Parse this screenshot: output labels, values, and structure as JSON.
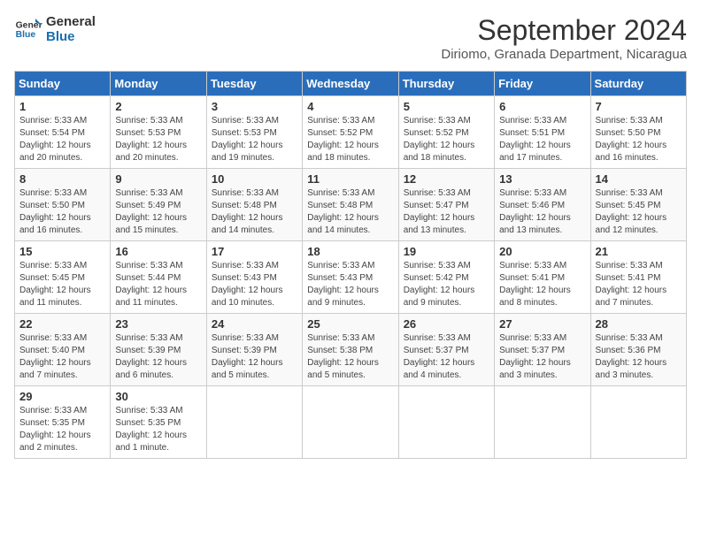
{
  "header": {
    "logo_line1": "General",
    "logo_line2": "Blue",
    "month_year": "September 2024",
    "location": "Diriomo, Granada Department, Nicaragua"
  },
  "weekdays": [
    "Sunday",
    "Monday",
    "Tuesday",
    "Wednesday",
    "Thursday",
    "Friday",
    "Saturday"
  ],
  "weeks": [
    [
      {
        "day": "1",
        "sunrise": "5:33 AM",
        "sunset": "5:54 PM",
        "daylight": "12 hours and 20 minutes."
      },
      {
        "day": "2",
        "sunrise": "5:33 AM",
        "sunset": "5:53 PM",
        "daylight": "12 hours and 20 minutes."
      },
      {
        "day": "3",
        "sunrise": "5:33 AM",
        "sunset": "5:53 PM",
        "daylight": "12 hours and 19 minutes."
      },
      {
        "day": "4",
        "sunrise": "5:33 AM",
        "sunset": "5:52 PM",
        "daylight": "12 hours and 18 minutes."
      },
      {
        "day": "5",
        "sunrise": "5:33 AM",
        "sunset": "5:52 PM",
        "daylight": "12 hours and 18 minutes."
      },
      {
        "day": "6",
        "sunrise": "5:33 AM",
        "sunset": "5:51 PM",
        "daylight": "12 hours and 17 minutes."
      },
      {
        "day": "7",
        "sunrise": "5:33 AM",
        "sunset": "5:50 PM",
        "daylight": "12 hours and 16 minutes."
      }
    ],
    [
      {
        "day": "8",
        "sunrise": "5:33 AM",
        "sunset": "5:50 PM",
        "daylight": "12 hours and 16 minutes."
      },
      {
        "day": "9",
        "sunrise": "5:33 AM",
        "sunset": "5:49 PM",
        "daylight": "12 hours and 15 minutes."
      },
      {
        "day": "10",
        "sunrise": "5:33 AM",
        "sunset": "5:48 PM",
        "daylight": "12 hours and 14 minutes."
      },
      {
        "day": "11",
        "sunrise": "5:33 AM",
        "sunset": "5:48 PM",
        "daylight": "12 hours and 14 minutes."
      },
      {
        "day": "12",
        "sunrise": "5:33 AM",
        "sunset": "5:47 PM",
        "daylight": "12 hours and 13 minutes."
      },
      {
        "day": "13",
        "sunrise": "5:33 AM",
        "sunset": "5:46 PM",
        "daylight": "12 hours and 13 minutes."
      },
      {
        "day": "14",
        "sunrise": "5:33 AM",
        "sunset": "5:45 PM",
        "daylight": "12 hours and 12 minutes."
      }
    ],
    [
      {
        "day": "15",
        "sunrise": "5:33 AM",
        "sunset": "5:45 PM",
        "daylight": "12 hours and 11 minutes."
      },
      {
        "day": "16",
        "sunrise": "5:33 AM",
        "sunset": "5:44 PM",
        "daylight": "12 hours and 11 minutes."
      },
      {
        "day": "17",
        "sunrise": "5:33 AM",
        "sunset": "5:43 PM",
        "daylight": "12 hours and 10 minutes."
      },
      {
        "day": "18",
        "sunrise": "5:33 AM",
        "sunset": "5:43 PM",
        "daylight": "12 hours and 9 minutes."
      },
      {
        "day": "19",
        "sunrise": "5:33 AM",
        "sunset": "5:42 PM",
        "daylight": "12 hours and 9 minutes."
      },
      {
        "day": "20",
        "sunrise": "5:33 AM",
        "sunset": "5:41 PM",
        "daylight": "12 hours and 8 minutes."
      },
      {
        "day": "21",
        "sunrise": "5:33 AM",
        "sunset": "5:41 PM",
        "daylight": "12 hours and 7 minutes."
      }
    ],
    [
      {
        "day": "22",
        "sunrise": "5:33 AM",
        "sunset": "5:40 PM",
        "daylight": "12 hours and 7 minutes."
      },
      {
        "day": "23",
        "sunrise": "5:33 AM",
        "sunset": "5:39 PM",
        "daylight": "12 hours and 6 minutes."
      },
      {
        "day": "24",
        "sunrise": "5:33 AM",
        "sunset": "5:39 PM",
        "daylight": "12 hours and 5 minutes."
      },
      {
        "day": "25",
        "sunrise": "5:33 AM",
        "sunset": "5:38 PM",
        "daylight": "12 hours and 5 minutes."
      },
      {
        "day": "26",
        "sunrise": "5:33 AM",
        "sunset": "5:37 PM",
        "daylight": "12 hours and 4 minutes."
      },
      {
        "day": "27",
        "sunrise": "5:33 AM",
        "sunset": "5:37 PM",
        "daylight": "12 hours and 3 minutes."
      },
      {
        "day": "28",
        "sunrise": "5:33 AM",
        "sunset": "5:36 PM",
        "daylight": "12 hours and 3 minutes."
      }
    ],
    [
      {
        "day": "29",
        "sunrise": "5:33 AM",
        "sunset": "5:35 PM",
        "daylight": "12 hours and 2 minutes."
      },
      {
        "day": "30",
        "sunrise": "5:33 AM",
        "sunset": "5:35 PM",
        "daylight": "12 hours and 1 minute."
      },
      null,
      null,
      null,
      null,
      null
    ]
  ]
}
